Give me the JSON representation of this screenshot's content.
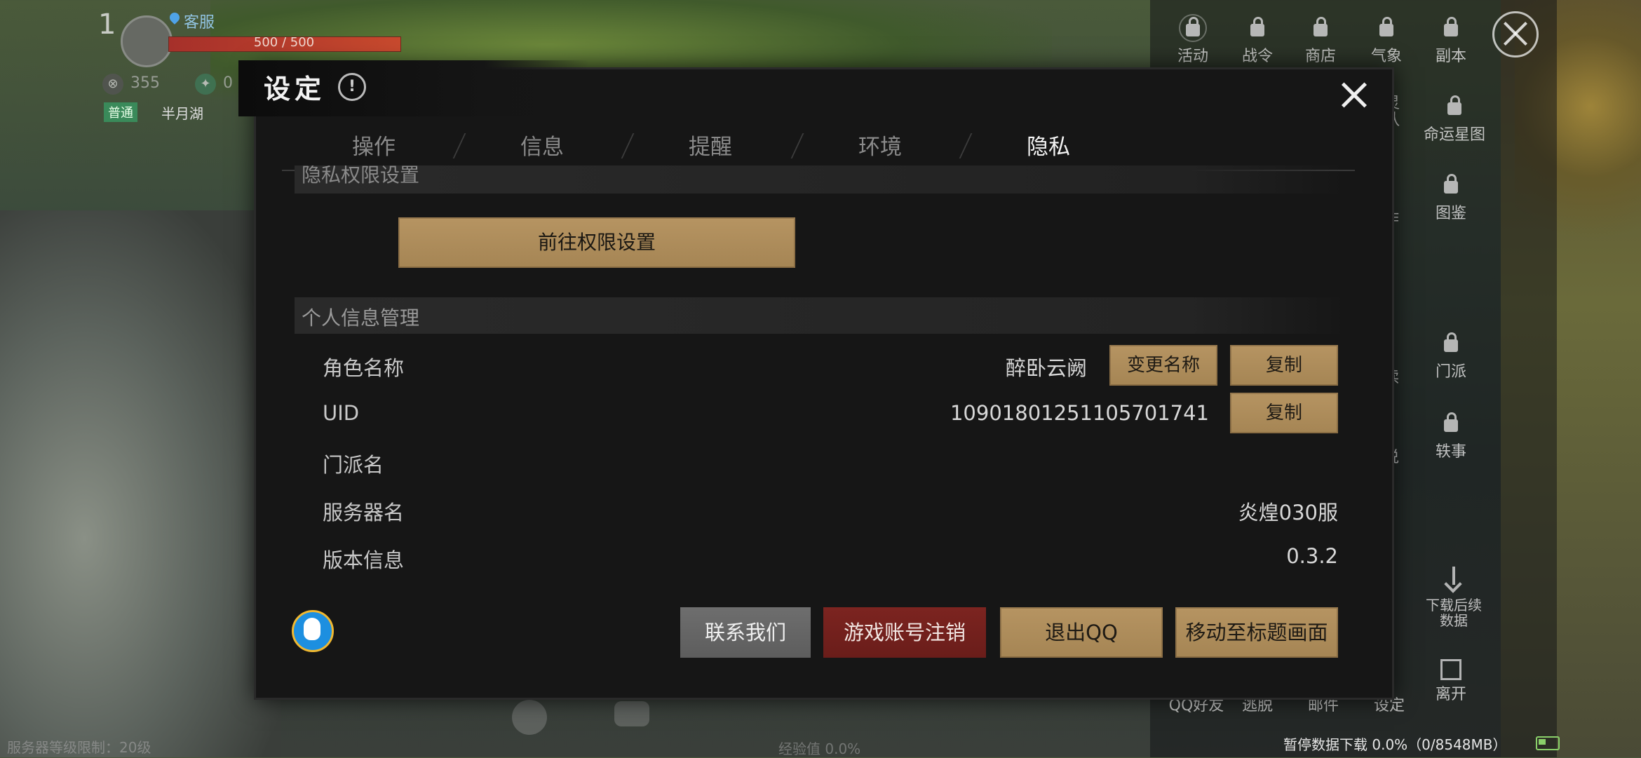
{
  "hud": {
    "level": "1",
    "server_tag": "客服",
    "hp_text": "500 / 500",
    "stat1": "355",
    "stat2": "0",
    "mode_badge": "普通",
    "location": "半月湖"
  },
  "side_menu": {
    "items": [
      {
        "label": "活动"
      },
      {
        "label": "战令"
      },
      {
        "label": "商店"
      },
      {
        "label": "气象"
      },
      {
        "label": "副本"
      },
      {
        "label": "护灵\n战队"
      },
      {
        "label": "命运星图"
      },
      {
        "label": "作"
      },
      {
        "label": "图鉴"
      },
      {
        "label": "读"
      },
      {
        "label": "门派"
      },
      {
        "label": "说"
      },
      {
        "label": "轶事"
      }
    ],
    "download_label": "下载后续\n数据",
    "bottom_items": [
      "QQ好友",
      "逃脱",
      "邮件",
      "设定",
      "离开"
    ]
  },
  "dialog": {
    "title": "设定",
    "tabs": [
      "操作",
      "信息",
      "提醒",
      "环境",
      "隐私"
    ],
    "active_tab": "隐私",
    "section_privacy": "隐私权限设置",
    "permission_button": "前往权限设置",
    "section_personal": "个人信息管理",
    "rows": {
      "role_name": {
        "label": "角色名称",
        "value": "醉卧云阙",
        "rename": "变更名称",
        "copy": "复制"
      },
      "uid": {
        "label": "UID",
        "value": "10901801251105701741",
        "copy": "复制"
      },
      "sect": {
        "label": "门派名",
        "value": ""
      },
      "server": {
        "label": "服务器名",
        "value": "炎煌030服"
      },
      "version": {
        "label": "版本信息",
        "value": "0.3.2"
      }
    },
    "footer": {
      "contact": "联系我们",
      "delete_account": "游戏账号注销",
      "logout_qq": "退出QQ",
      "to_title": "移动至标题画面"
    }
  },
  "bottom_hud": {
    "server_limit": "服务器等级限制：20级",
    "exp": "经验值 0.0%",
    "download_status": "暂停数据下载 0.0%（0/8548MB）"
  },
  "colors": {
    "gold_button": "#b69462",
    "red_button": "#7c2420",
    "gray_button": "#6e6e6e",
    "dialog_bg": "#161616"
  }
}
